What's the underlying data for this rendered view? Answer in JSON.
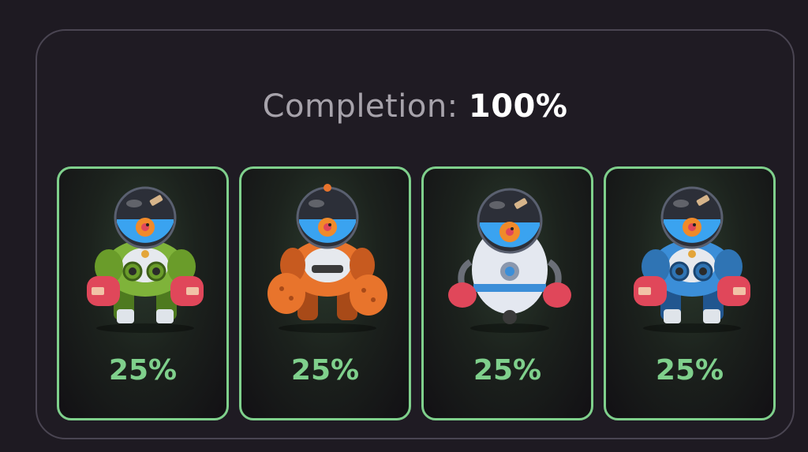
{
  "completion": {
    "label": "Completion:",
    "value": "100%"
  },
  "cards": [
    {
      "percent": "25%",
      "robot_color": "#7fb33a",
      "robot_dark": "#4e7a1f",
      "robot_type": "mech-robot"
    },
    {
      "percent": "25%",
      "robot_color": "#e8742c",
      "robot_dark": "#a84a18",
      "robot_type": "mech-robot"
    },
    {
      "percent": "25%",
      "robot_color": "#e4e8f0",
      "robot_dark": "#8a97ad",
      "robot_type": "capsule-robot"
    },
    {
      "percent": "25%",
      "robot_color": "#3b8ed8",
      "robot_dark": "#21568f",
      "robot_type": "mech-robot"
    }
  ],
  "colors": {
    "accent_green": "#7fd08c",
    "glove_red": "#e0475a",
    "dome_blue": "#3aa3f0",
    "fish_orange": "#f08a2a"
  }
}
